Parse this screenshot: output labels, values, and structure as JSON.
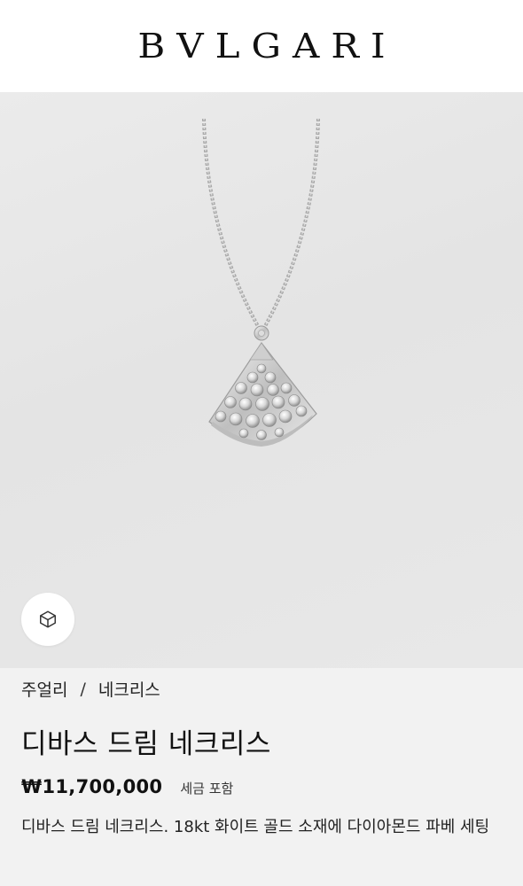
{
  "header": {
    "logo_text": "BVLGARI"
  },
  "hero": {
    "image_icon": "necklace-product-image",
    "view_3d_icon": "cube-icon"
  },
  "product": {
    "breadcrumb": [
      {
        "label": "주얼리"
      },
      {
        "label": "네크리스"
      }
    ],
    "breadcrumb_separator": "/",
    "title": "디바스 드림 네크리스",
    "price": "₩11,700,000",
    "tax_note": "세금 포함",
    "description": "디바스 드림 네크리스. 18kt 화이트 골드 소재에 다이아몬드 파베 세팅"
  }
}
